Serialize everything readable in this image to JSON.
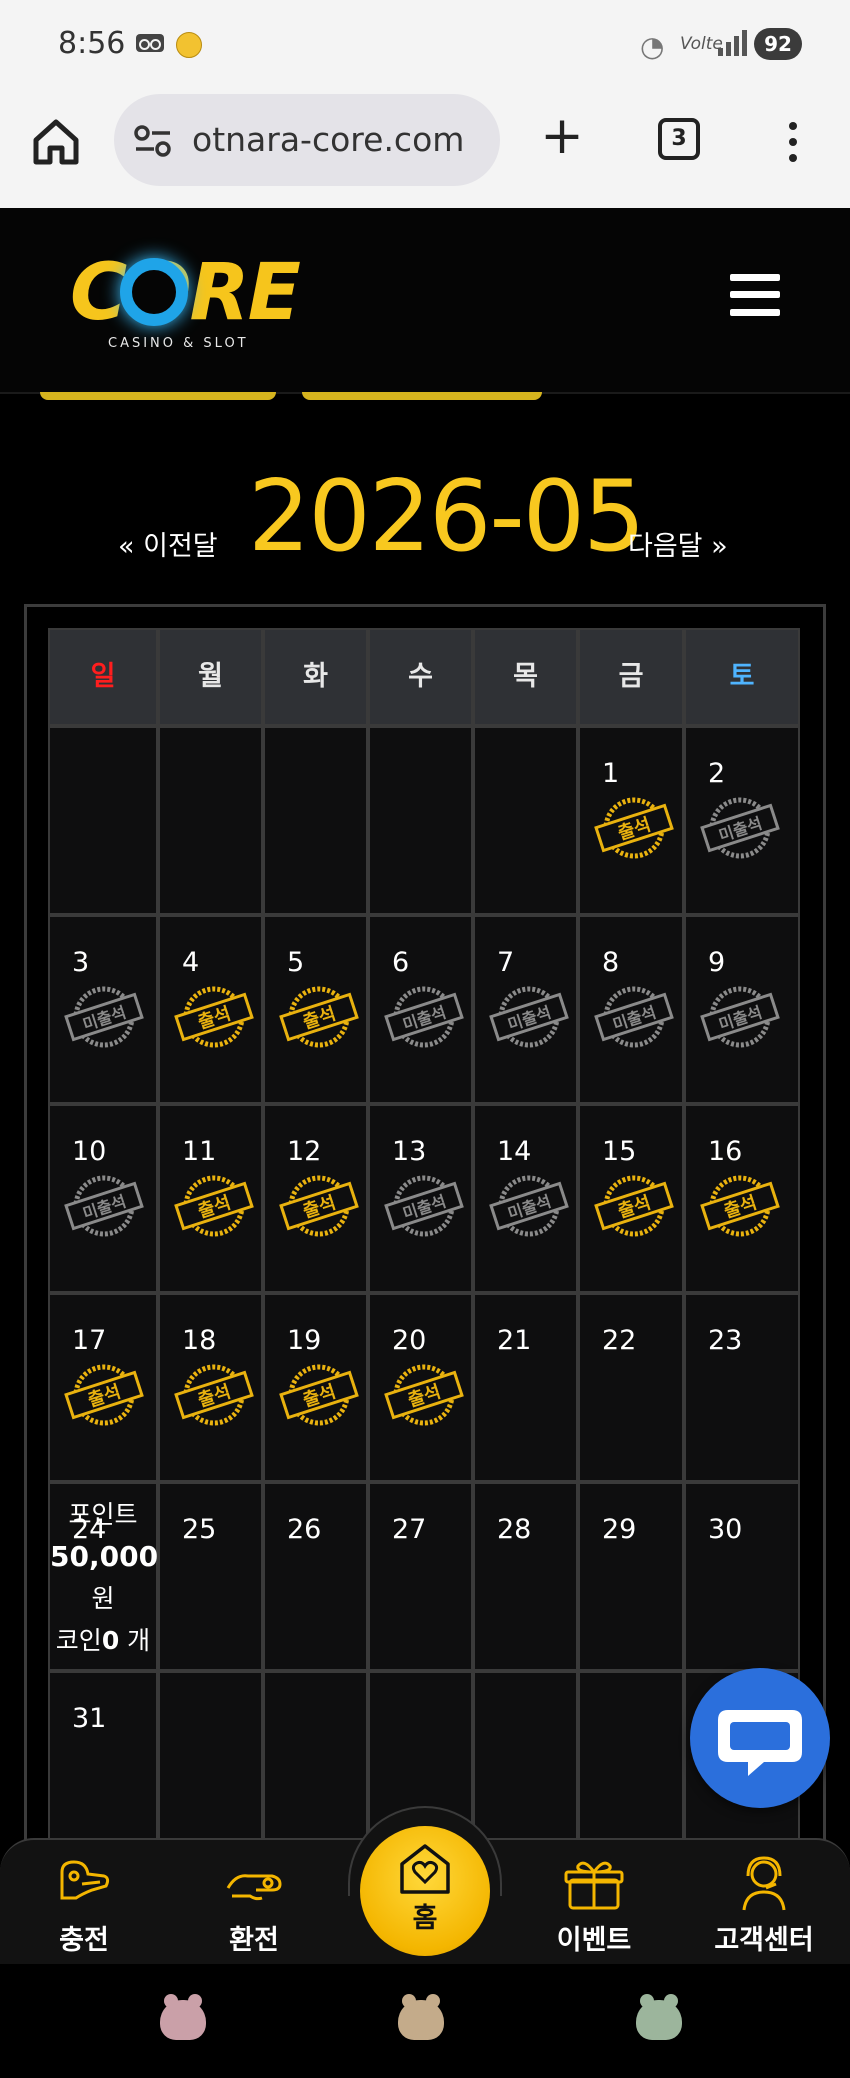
{
  "status_bar": {
    "time": "8:56",
    "volte": "Volte",
    "battery": "92"
  },
  "browser": {
    "url": "otnara-core.com",
    "tab_count": "3"
  },
  "site": {
    "logo_main": "CORE",
    "logo_sub": "CASINO & SLOT"
  },
  "month_nav": {
    "prev": "« 이전달",
    "title": "2026-05",
    "next": "다음달 »"
  },
  "calendar": {
    "weekdays": [
      {
        "label": "일",
        "color": "#ff1e1e"
      },
      {
        "label": "월",
        "color": "#e8e8e8"
      },
      {
        "label": "화",
        "color": "#e8e8e8"
      },
      {
        "label": "수",
        "color": "#e8e8e8"
      },
      {
        "label": "목",
        "color": "#e8e8e8"
      },
      {
        "label": "금",
        "color": "#e8e8e8"
      },
      {
        "label": "토",
        "color": "#4fb4ff"
      }
    ],
    "stamp_labels": {
      "attended": "출석",
      "absent": "미출석"
    },
    "stamp_colors": {
      "attended": "#e9b20f",
      "absent": "#8a8a8a"
    },
    "weeks": [
      [
        null,
        null,
        null,
        null,
        null,
        {
          "day": "1",
          "stamp": "attended"
        },
        {
          "day": "2",
          "stamp": "absent"
        }
      ],
      [
        {
          "day": "3",
          "stamp": "absent"
        },
        {
          "day": "4",
          "stamp": "attended"
        },
        {
          "day": "5",
          "stamp": "attended"
        },
        {
          "day": "6",
          "stamp": "absent"
        },
        {
          "day": "7",
          "stamp": "absent"
        },
        {
          "day": "8",
          "stamp": "absent"
        },
        {
          "day": "9",
          "stamp": "absent"
        }
      ],
      [
        {
          "day": "10",
          "stamp": "absent"
        },
        {
          "day": "11",
          "stamp": "attended"
        },
        {
          "day": "12",
          "stamp": "attended"
        },
        {
          "day": "13",
          "stamp": "absent"
        },
        {
          "day": "14",
          "stamp": "absent"
        },
        {
          "day": "15",
          "stamp": "attended"
        },
        {
          "day": "16",
          "stamp": "attended"
        }
      ],
      [
        {
          "day": "17",
          "stamp": "attended"
        },
        {
          "day": "18",
          "stamp": "attended"
        },
        {
          "day": "19",
          "stamp": "attended"
        },
        {
          "day": "20",
          "stamp": "attended"
        },
        {
          "day": "21",
          "stamp": null
        },
        {
          "day": "22",
          "stamp": null
        },
        {
          "day": "23",
          "stamp": null
        }
      ],
      [
        {
          "day": "24",
          "stamp": null
        },
        {
          "day": "25",
          "stamp": null
        },
        {
          "day": "26",
          "stamp": null
        },
        {
          "day": "27",
          "stamp": null
        },
        {
          "day": "28",
          "stamp": null
        },
        {
          "day": "29",
          "stamp": null
        },
        {
          "day": "30",
          "stamp": null
        }
      ],
      [
        {
          "day": "31",
          "stamp": null
        },
        null,
        null,
        null,
        null,
        null,
        null
      ]
    ],
    "points_overlay": {
      "point_label": "포인트",
      "point_value": "50,000",
      "point_unit": "원",
      "coin_label": "코인",
      "coin_value": "0",
      "coin_unit": "개"
    }
  },
  "bottom_nav": {
    "charge": "충전",
    "exchange": "환전",
    "home": "홈",
    "event": "이벤트",
    "support": "고객센터"
  },
  "colors": {
    "gold": "#f8c81f",
    "chat_blue": "#2b6fdc"
  }
}
